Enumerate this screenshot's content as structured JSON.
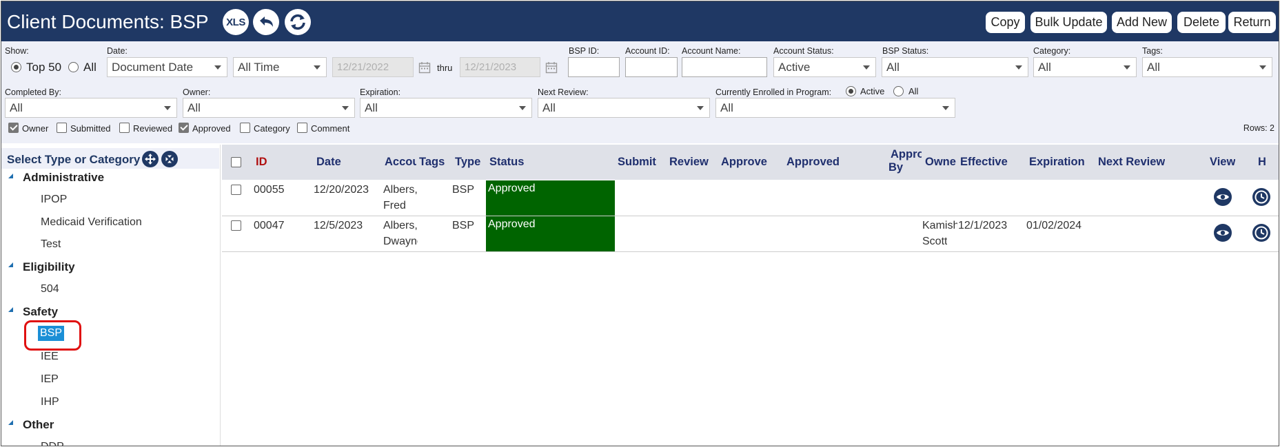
{
  "header": {
    "title": "Client Documents: BSP",
    "xls_label": "XLS",
    "buttons": {
      "copy": "Copy",
      "bulk_update": "Bulk Update",
      "add_new": "Add New",
      "delete": "Delete",
      "return": "Return"
    }
  },
  "filters": {
    "show_label": "Show:",
    "show_top50": "Top 50",
    "show_all": "All",
    "date_label": "Date:",
    "date_type": "Document Date",
    "date_range": "All Time",
    "date_from": "12/21/2022",
    "thru_label": "thru",
    "date_to": "12/21/2023",
    "bsp_id_label": "BSP ID:",
    "bsp_id_value": "",
    "account_id_label": "Account ID:",
    "account_id_value": "",
    "account_name_label": "Account Name:",
    "account_name_value": "",
    "account_status_label": "Account Status:",
    "account_status_value": "Active",
    "bsp_status_label": "BSP Status:",
    "bsp_status_value": "All",
    "category_label": "Category:",
    "category_value": "All",
    "tags_label": "Tags:",
    "tags_value": "All",
    "completed_by_label": "Completed By:",
    "completed_by_value": "All",
    "owner_label": "Owner:",
    "owner_value": "All",
    "expiration_label": "Expiration:",
    "expiration_value": "All",
    "next_review_label": "Next Review:",
    "next_review_value": "All",
    "enrolled_label": "Currently Enrolled in Program:",
    "enrolled_active": "Active",
    "enrolled_all": "All",
    "enrolled_value": "All",
    "columns": {
      "owner": "Owner",
      "submitted": "Submitted",
      "reviewed": "Reviewed",
      "approved": "Approved",
      "category": "Category",
      "comment": "Comment"
    },
    "rows_label": "Rows: 2"
  },
  "tree": {
    "title": "Select Type or Category",
    "categories": [
      {
        "label": "Administrative",
        "items": [
          "IPOP",
          "Medicaid Verification",
          "Test"
        ]
      },
      {
        "label": "Eligibility",
        "items": [
          "504"
        ]
      },
      {
        "label": "Safety",
        "items": [
          "BSP",
          "IEE",
          "IEP",
          "IHP"
        ]
      },
      {
        "label": "Other",
        "items": [
          "DDP"
        ]
      }
    ],
    "selected": "BSP"
  },
  "grid": {
    "headers": {
      "id": "ID",
      "date": "Date",
      "account": "Account",
      "tags": "Tags",
      "type": "Type",
      "status": "Status",
      "submit": "Submit",
      "review": "Review",
      "approve": "Approve",
      "approved": "Approved",
      "approved_by_1": "Approved",
      "approved_by_2": "By",
      "owner": "Owner",
      "effective": "Effective",
      "expiration": "Expiration",
      "next_review": "Next Review",
      "view": "View",
      "h": "H"
    },
    "rows": [
      {
        "id": "00055",
        "date": "12/20/2023",
        "account_1": "Albers,",
        "account_2": "Fred",
        "type": "BSP",
        "status": "Approved",
        "owner_1": "",
        "owner_2": "",
        "effective": "",
        "expiration": ""
      },
      {
        "id": "00047",
        "date": "12/5/2023",
        "account_1": "Albers,",
        "account_2": "Dwayne",
        "type": "BSP",
        "status": "Approved",
        "owner_1": "Kamisha",
        "owner_2": "Scott",
        "effective": "12/1/2023",
        "expiration": "01/02/2024"
      }
    ]
  },
  "colors": {
    "header_bg": "#1f3864",
    "filter_bg": "#eef0f8",
    "status_approved": "#006400",
    "selected_leaf": "#1b8fd6",
    "highlight": "#e01010"
  }
}
